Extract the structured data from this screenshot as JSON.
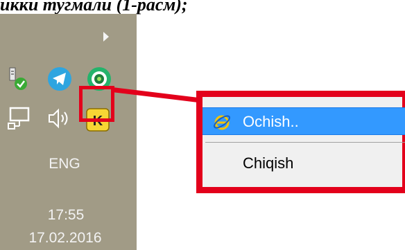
{
  "caption": "икки тугмали (1-расм);",
  "tray": {
    "lang": "ENG",
    "time": "17:55",
    "date": "17.02.2016",
    "k_label": "K"
  },
  "context_menu": {
    "items": [
      {
        "label": "Ochish..",
        "icon": "internet-explorer-icon",
        "highlighted": true
      },
      {
        "label": "Chiqish",
        "highlighted": false
      }
    ]
  },
  "colors": {
    "highlight_red": "#e3001b",
    "menu_selection": "#3399ff",
    "tray_bg": "#a19b86",
    "k_icon_yellow": "#f7d634"
  }
}
